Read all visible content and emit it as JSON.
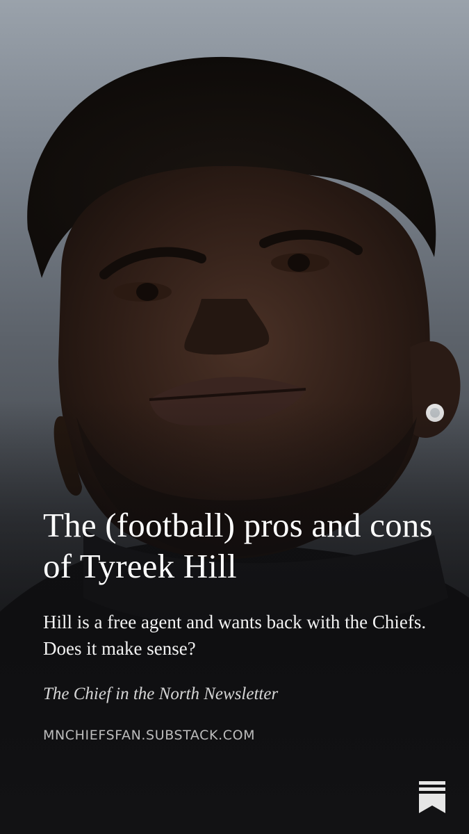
{
  "post": {
    "title": "The (football) pros and cons of Tyreek Hill",
    "subtitle": "Hill is a free agent and wants back with the Chiefs. Does it make sense?",
    "publication": "The Chief in the North Newsletter",
    "domain": "MNCHIEFSFAN.SUBSTACK.COM"
  },
  "icons": {
    "brand_logo": "substack-bookmark-icon"
  },
  "colors": {
    "text_primary": "#ffffff",
    "text_secondary": "#d6d6d6",
    "domain_text": "#bdbdbd",
    "logo": "#e6e6e6"
  }
}
